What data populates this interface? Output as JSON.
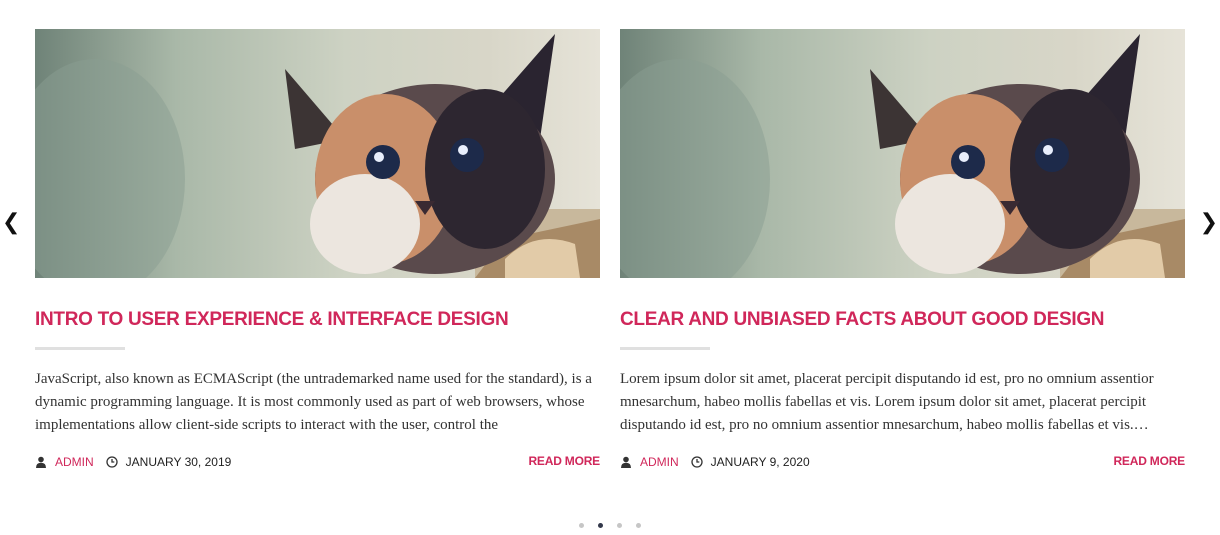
{
  "carousel": {
    "prev_icon": "chevron-left-icon",
    "next_icon": "chevron-right-icon",
    "prev_glyph": "❮",
    "next_glyph": "❯",
    "dots_count": 4,
    "active_dot": 1
  },
  "posts": [
    {
      "image": "kitten-photo",
      "title": "INTRO TO USER EXPERIENCE & INTERFACE DESIGN",
      "excerpt": "JavaScript, also known as ECMAScript (the untrademarked name used for the standard), is a dynamic programming language. It is most commonly used as part of web browsers, whose implementations allow client-side scripts to interact with the user, control the",
      "author": "ADMIN",
      "date": "JANUARY 30, 2019",
      "read_more": "READ MORE"
    },
    {
      "image": "kitten-photo",
      "title": "CLEAR AND UNBIASED FACTS ABOUT GOOD DESIGN",
      "excerpt": "Lorem ipsum dolor sit amet, placerat percipit disputando id est, pro no omnium assentior mnesarchum, habeo mollis fabellas et vis. Lorem ipsum dolor sit amet, placerat percipit disputando id est, pro no omnium assentior mnesarchum, habeo mollis fabellas et vis.…",
      "author": "ADMIN",
      "date": "JANUARY 9, 2020",
      "read_more": "READ MORE"
    }
  ],
  "colors": {
    "accent": "#d0275a",
    "text": "#333333",
    "divider": "#e0e0e0",
    "dot_active": "#33384a",
    "dot_inactive": "#c6c6c6"
  }
}
